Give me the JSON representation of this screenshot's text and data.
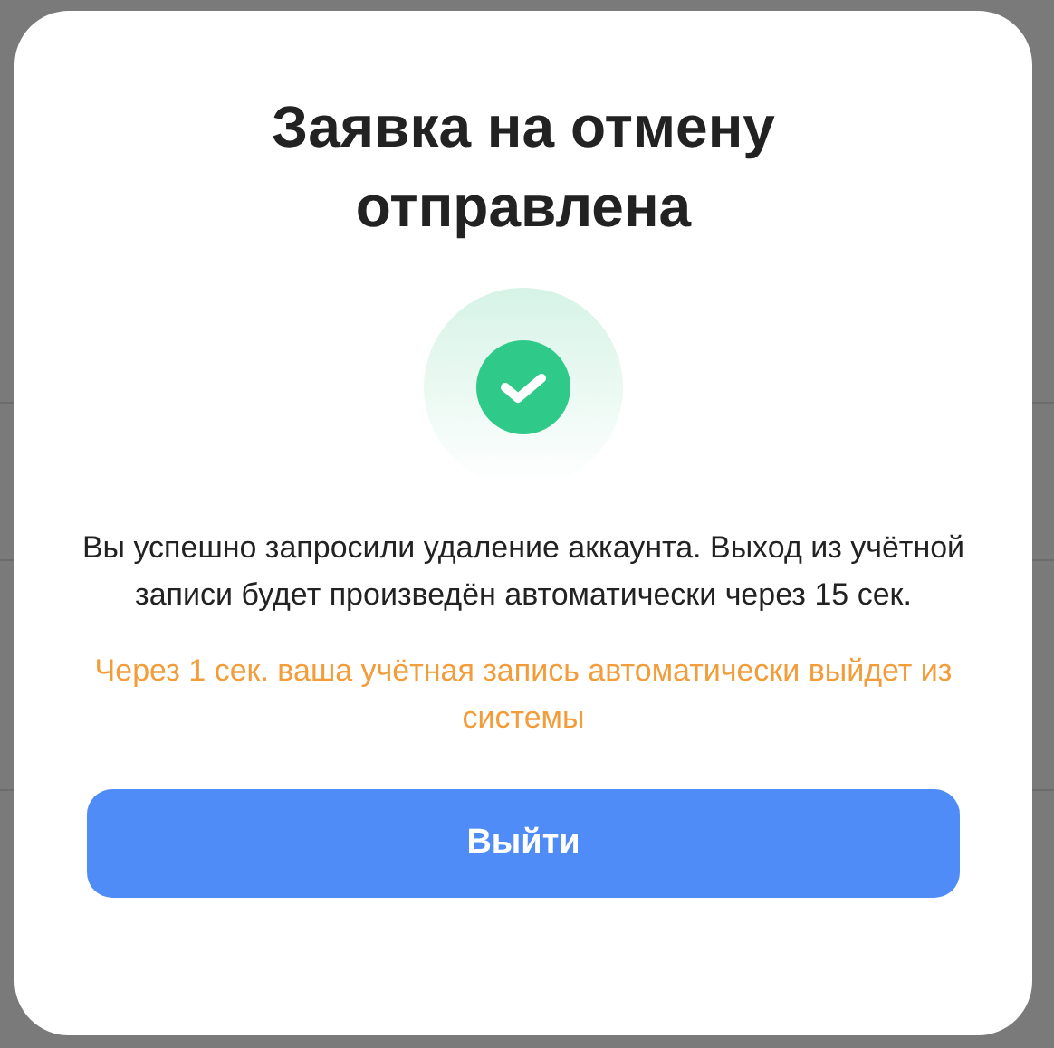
{
  "dialog": {
    "title": "Заявка на отмену отправлена",
    "message": "Вы успешно запросили удаление аккаунта. Выход из учётной записи будет произведён автоматически через 15 сек.",
    "countdown_notice": "Через 1 сек. ваша учётная запись автоматически выйдет из системы",
    "button": "Выйти"
  }
}
